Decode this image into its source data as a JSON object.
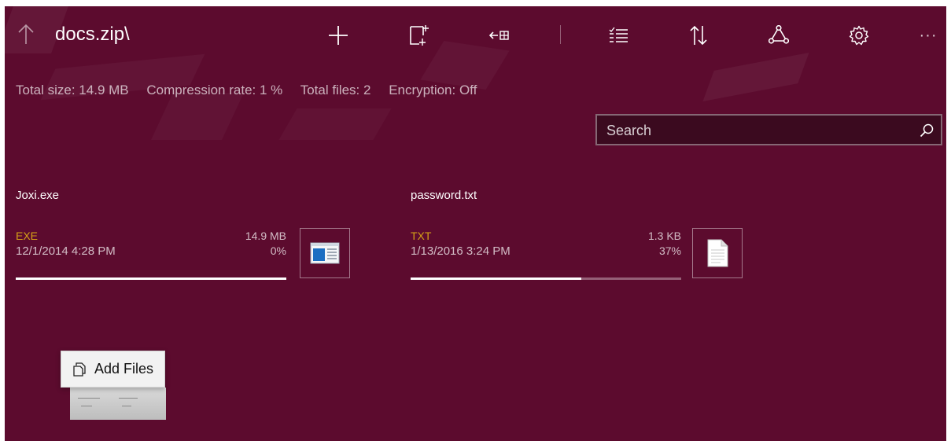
{
  "window": {
    "path": "docs.zip\\"
  },
  "toolbar": {
    "more_label": "···"
  },
  "stats": {
    "total_size": "Total size: 14.9 MB",
    "compression_rate": "Compression rate: 1 %",
    "total_files": "Total files: 2",
    "encryption": "Encryption: Off"
  },
  "search": {
    "placeholder": "Search"
  },
  "files": [
    {
      "name": "Joxi.exe",
      "type": "EXE",
      "size": "14.9 MB",
      "date": "12/1/2014 4:28 PM",
      "rate": "0%",
      "progress": 1.0,
      "icon": "exe-window-icon"
    },
    {
      "name": "password.txt",
      "type": "TXT",
      "size": "1.3 KB",
      "date": "1/13/2016 3:24 PM",
      "rate": "37%",
      "progress": 0.63,
      "icon": "text-document-icon"
    }
  ],
  "drag_tooltip": {
    "label": "Add Files"
  },
  "colors": {
    "background": "#5c0b2e",
    "file_type": "#d4a017",
    "search_bg": "#3b0a1f",
    "exe_icon_blue": "#1b6ec2"
  }
}
